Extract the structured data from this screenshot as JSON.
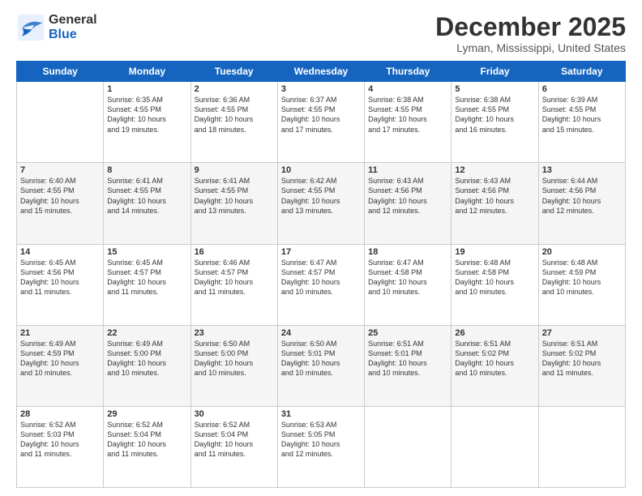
{
  "logo": {
    "line1": "General",
    "line2": "Blue"
  },
  "header": {
    "month_year": "December 2025",
    "location": "Lyman, Mississippi, United States"
  },
  "days_of_week": [
    "Sunday",
    "Monday",
    "Tuesday",
    "Wednesday",
    "Thursday",
    "Friday",
    "Saturday"
  ],
  "weeks": [
    [
      {
        "day": "",
        "info": ""
      },
      {
        "day": "1",
        "info": "Sunrise: 6:35 AM\nSunset: 4:55 PM\nDaylight: 10 hours\nand 19 minutes."
      },
      {
        "day": "2",
        "info": "Sunrise: 6:36 AM\nSunset: 4:55 PM\nDaylight: 10 hours\nand 18 minutes."
      },
      {
        "day": "3",
        "info": "Sunrise: 6:37 AM\nSunset: 4:55 PM\nDaylight: 10 hours\nand 17 minutes."
      },
      {
        "day": "4",
        "info": "Sunrise: 6:38 AM\nSunset: 4:55 PM\nDaylight: 10 hours\nand 17 minutes."
      },
      {
        "day": "5",
        "info": "Sunrise: 6:38 AM\nSunset: 4:55 PM\nDaylight: 10 hours\nand 16 minutes."
      },
      {
        "day": "6",
        "info": "Sunrise: 6:39 AM\nSunset: 4:55 PM\nDaylight: 10 hours\nand 15 minutes."
      }
    ],
    [
      {
        "day": "7",
        "info": "Sunrise: 6:40 AM\nSunset: 4:55 PM\nDaylight: 10 hours\nand 15 minutes."
      },
      {
        "day": "8",
        "info": "Sunrise: 6:41 AM\nSunset: 4:55 PM\nDaylight: 10 hours\nand 14 minutes."
      },
      {
        "day": "9",
        "info": "Sunrise: 6:41 AM\nSunset: 4:55 PM\nDaylight: 10 hours\nand 13 minutes."
      },
      {
        "day": "10",
        "info": "Sunrise: 6:42 AM\nSunset: 4:55 PM\nDaylight: 10 hours\nand 13 minutes."
      },
      {
        "day": "11",
        "info": "Sunrise: 6:43 AM\nSunset: 4:56 PM\nDaylight: 10 hours\nand 12 minutes."
      },
      {
        "day": "12",
        "info": "Sunrise: 6:43 AM\nSunset: 4:56 PM\nDaylight: 10 hours\nand 12 minutes."
      },
      {
        "day": "13",
        "info": "Sunrise: 6:44 AM\nSunset: 4:56 PM\nDaylight: 10 hours\nand 12 minutes."
      }
    ],
    [
      {
        "day": "14",
        "info": "Sunrise: 6:45 AM\nSunset: 4:56 PM\nDaylight: 10 hours\nand 11 minutes."
      },
      {
        "day": "15",
        "info": "Sunrise: 6:45 AM\nSunset: 4:57 PM\nDaylight: 10 hours\nand 11 minutes."
      },
      {
        "day": "16",
        "info": "Sunrise: 6:46 AM\nSunset: 4:57 PM\nDaylight: 10 hours\nand 11 minutes."
      },
      {
        "day": "17",
        "info": "Sunrise: 6:47 AM\nSunset: 4:57 PM\nDaylight: 10 hours\nand 10 minutes."
      },
      {
        "day": "18",
        "info": "Sunrise: 6:47 AM\nSunset: 4:58 PM\nDaylight: 10 hours\nand 10 minutes."
      },
      {
        "day": "19",
        "info": "Sunrise: 6:48 AM\nSunset: 4:58 PM\nDaylight: 10 hours\nand 10 minutes."
      },
      {
        "day": "20",
        "info": "Sunrise: 6:48 AM\nSunset: 4:59 PM\nDaylight: 10 hours\nand 10 minutes."
      }
    ],
    [
      {
        "day": "21",
        "info": "Sunrise: 6:49 AM\nSunset: 4:59 PM\nDaylight: 10 hours\nand 10 minutes."
      },
      {
        "day": "22",
        "info": "Sunrise: 6:49 AM\nSunset: 5:00 PM\nDaylight: 10 hours\nand 10 minutes."
      },
      {
        "day": "23",
        "info": "Sunrise: 6:50 AM\nSunset: 5:00 PM\nDaylight: 10 hours\nand 10 minutes."
      },
      {
        "day": "24",
        "info": "Sunrise: 6:50 AM\nSunset: 5:01 PM\nDaylight: 10 hours\nand 10 minutes."
      },
      {
        "day": "25",
        "info": "Sunrise: 6:51 AM\nSunset: 5:01 PM\nDaylight: 10 hours\nand 10 minutes."
      },
      {
        "day": "26",
        "info": "Sunrise: 6:51 AM\nSunset: 5:02 PM\nDaylight: 10 hours\nand 10 minutes."
      },
      {
        "day": "27",
        "info": "Sunrise: 6:51 AM\nSunset: 5:02 PM\nDaylight: 10 hours\nand 11 minutes."
      }
    ],
    [
      {
        "day": "28",
        "info": "Sunrise: 6:52 AM\nSunset: 5:03 PM\nDaylight: 10 hours\nand 11 minutes."
      },
      {
        "day": "29",
        "info": "Sunrise: 6:52 AM\nSunset: 5:04 PM\nDaylight: 10 hours\nand 11 minutes."
      },
      {
        "day": "30",
        "info": "Sunrise: 6:52 AM\nSunset: 5:04 PM\nDaylight: 10 hours\nand 11 minutes."
      },
      {
        "day": "31",
        "info": "Sunrise: 6:53 AM\nSunset: 5:05 PM\nDaylight: 10 hours\nand 12 minutes."
      },
      {
        "day": "",
        "info": ""
      },
      {
        "day": "",
        "info": ""
      },
      {
        "day": "",
        "info": ""
      }
    ]
  ]
}
